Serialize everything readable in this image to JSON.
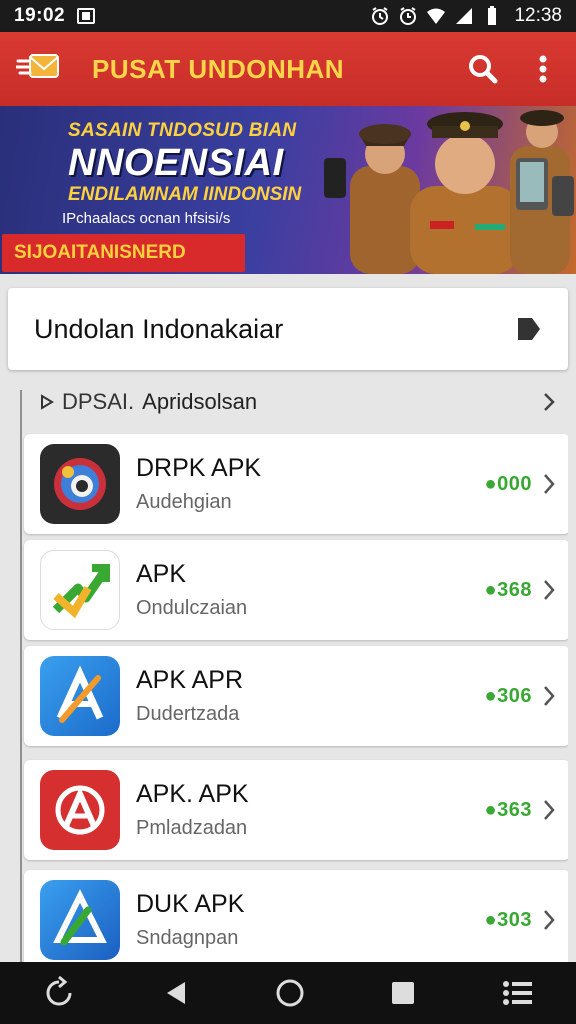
{
  "status_bar": {
    "time_left": "19:02",
    "time_right": "12:38"
  },
  "app_bar": {
    "title": "PUSAT UNDONHAN"
  },
  "banner": {
    "line1": "SASAIN TNDOSUD BIAN",
    "line2": "NNOENSIAI",
    "line3": "ENDILAMNAM IINDONSIN",
    "line4": "IPchaalacs ocnan hfsisi/s",
    "cta": "SIJOAITANISNERD",
    "colors": {
      "cta_bg": "#d82a2a",
      "text_accent": "#ffd23d"
    }
  },
  "section": {
    "title": "Undolan Indonakaiar"
  },
  "sub_header": {
    "prefix": "DPSAI.",
    "label": "Apridsolsan"
  },
  "apps": [
    {
      "name": "DRPK APK",
      "sub": "Audehgian",
      "count": "●000",
      "icon": "dark-circle-icon"
    },
    {
      "name": "APK",
      "sub": "Ondulczaian",
      "count": "●368",
      "icon": "green-arrow-icon"
    },
    {
      "name": "APK APR",
      "sub": "Dudertzada",
      "count": "●306",
      "icon": "blue-a-icon"
    },
    {
      "name": "APK.  APK",
      "sub": "Pmladzadan",
      "count": "●363",
      "icon": "red-a-icon"
    },
    {
      "name": "DUK APK",
      "sub": "Sndagnpan",
      "count": "●303",
      "icon": "blue-triangle-icon"
    }
  ],
  "colors": {
    "app_bar": "#d93a32",
    "title": "#ffd54a",
    "count_green": "#39a833"
  }
}
